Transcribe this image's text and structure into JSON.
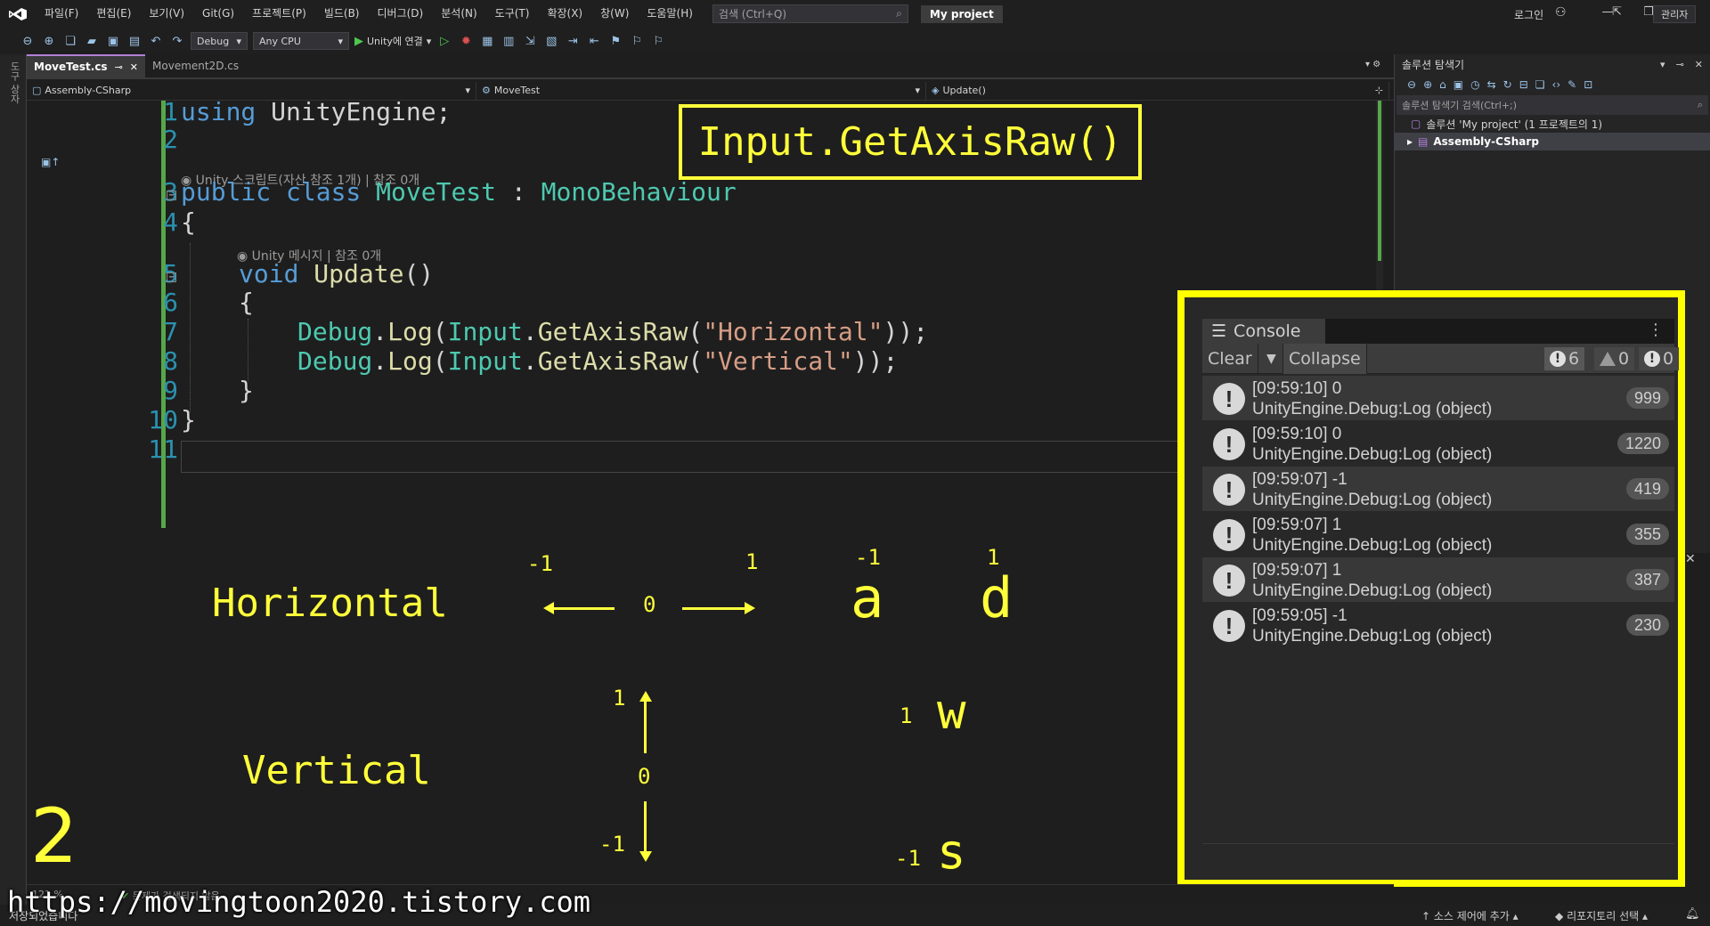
{
  "menu": {
    "items": [
      "파일(F)",
      "편집(E)",
      "보기(V)",
      "Git(G)",
      "프로젝트(P)",
      "빌드(B)",
      "디버그(D)",
      "분석(N)",
      "도구(T)",
      "확장(X)",
      "창(W)",
      "도움말(H)"
    ],
    "search_placeholder": "검색 (Ctrl+Q)",
    "project_name": "My project",
    "login": "로그인"
  },
  "toolbar": {
    "config": "Debug",
    "platform": "Any CPU",
    "run_label": "Unity에 연결",
    "admin_label": "관리자"
  },
  "left_strip": {
    "label": "도구 상자"
  },
  "tabs": [
    {
      "label": "MoveTest.cs",
      "active": true
    },
    {
      "label": "Movement2D.cs",
      "active": false
    }
  ],
  "navbar": {
    "project": "Assembly-CSharp",
    "class": "MoveTest",
    "member": "Update()"
  },
  "code": {
    "line_numbers": [
      "1",
      "2",
      "3",
      "4",
      "5",
      "6",
      "7",
      "8",
      "9",
      "10",
      "11"
    ],
    "l1_kw": "using",
    "l1_rest": " UnityEngine;",
    "codelens_class": "Unity 스크립트(자산 참조 1개) | 참조 0개",
    "l3_kw": "public class",
    "l3_name": " MoveTest",
    "l3_colon": " : ",
    "l3_base": "MonoBehaviour",
    "l4": "{",
    "codelens_method": "Unity 메시지 | 참조 0개",
    "l5_kw": "void",
    "l5_name": " Update",
    "l5_rest": "()",
    "l6": "{",
    "l7_cls": "Debug",
    "l7_dot": ".",
    "l7_m": "Log",
    "l7_p": "(",
    "l7_cls2": "Input",
    "l7_dot2": ".",
    "l7_m2": "GetAxisRaw",
    "l7_p2": "(",
    "l7_str": "\"Horizontal\"",
    "l7_end": "));",
    "l8_cls": "Debug",
    "l8_dot": ".",
    "l8_m": "Log",
    "l8_p": "(",
    "l8_cls2": "Input",
    "l8_dot2": ".",
    "l8_m2": "GetAxisRaw",
    "l8_p2": "(",
    "l8_str": "\"Vertical\"",
    "l8_end": "));",
    "l9": "}",
    "l10": "}"
  },
  "annotations": {
    "box": "Input.GetAxisRaw()",
    "horizontal": "Horizontal",
    "vertical": "Vertical",
    "h_minus": "-1",
    "h_zero": "0",
    "h_plus": "1",
    "a_val": "-1",
    "a_key": "a",
    "d_val": "1",
    "d_key": "d",
    "v_plus": "1",
    "v_zero": "0",
    "v_minus": "-1",
    "w_val": "1",
    "w_key": "w",
    "s_val": "-1",
    "s_key": "s",
    "step": "2"
  },
  "solution": {
    "title": "솔루션 탐색기",
    "search_placeholder": "솔루션 탐색기 검색(Ctrl+;)",
    "solution_row": "솔루션 'My project' (1 프로젝트의 1)",
    "assembly_row": "Assembly-CSharp"
  },
  "console": {
    "tab": "Console",
    "clear": "Clear",
    "collapse": "Collapse",
    "count_log": "6",
    "count_warn": "0",
    "count_error": "0",
    "logs": [
      {
        "line1": "[09:59:10] 0",
        "line2": "UnityEngine.Debug:Log (object)",
        "count": "999"
      },
      {
        "line1": "[09:59:10] 0",
        "line2": "UnityEngine.Debug:Log (object)",
        "count": "1220"
      },
      {
        "line1": "[09:59:07] -1",
        "line2": "UnityEngine.Debug:Log (object)",
        "count": "419"
      },
      {
        "line1": "[09:59:07] 1",
        "line2": "UnityEngine.Debug:Log (object)",
        "count": "355"
      },
      {
        "line1": "[09:59:07] 1",
        "line2": "UnityEngine.Debug:Log (object)",
        "count": "387"
      },
      {
        "line1": "[09:59:05] -1",
        "line2": "UnityEngine.Debug:Log (object)",
        "count": "230"
      }
    ]
  },
  "editor_status": {
    "zoom": "121 %",
    "issues": "문제가 검색되지 않음"
  },
  "status": {
    "ready": "저장되었습니다",
    "source_control": "소스 제어에 추가",
    "repo": "리포지토리 선택"
  },
  "watermark": "https://movingtoon2020.tistory.com",
  "colors": {
    "annotation": "#ffff3a",
    "console_frame": "#ffff00",
    "keyword": "#569cd6",
    "type": "#4ec9b0",
    "method": "#dcdcaa",
    "string": "#d69d85",
    "line_number": "#2b91af"
  }
}
